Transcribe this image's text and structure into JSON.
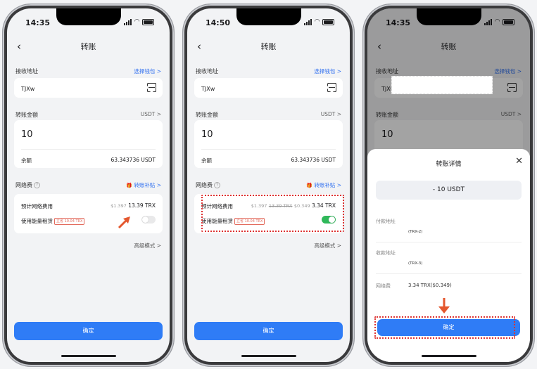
{
  "colors": {
    "accent": "#2f7cf6",
    "toggle_on": "#2fb85a",
    "highlight": "#dd3333"
  },
  "screens": [
    {
      "time": "14:35",
      "nav_title": "转账",
      "recipient_label": "接收地址",
      "select_wallet": "选择钱包 >",
      "address": "TJXw",
      "amount_label": "转账金额",
      "currency": "USDT >",
      "amount": "10",
      "balance_label": "余额",
      "balance_value": "63.343736 USDT",
      "fee_label": "网络费",
      "subsidy": "转账补贴 >",
      "estimated_fee_label": "预计网络费用",
      "fee_old": "$1.397",
      "fee_value": "13.39 TRX",
      "energy_rent_label": "使用能量租赁",
      "energy_tag": "立省 10.04 TRX",
      "energy_rent_on": false,
      "advanced": "高级模式 >",
      "confirm": "确定"
    },
    {
      "time": "14:50",
      "nav_title": "转账",
      "recipient_label": "接收地址",
      "select_wallet": "选择钱包 >",
      "address": "TJXw",
      "amount_label": "转账金额",
      "currency": "USDT >",
      "amount": "10",
      "balance_label": "余额",
      "balance_value": "63.343736 USDT",
      "fee_label": "网络费",
      "subsidy": "转账补贴 >",
      "estimated_fee_label": "预计网络费用",
      "fee_old": "$1.397",
      "fee_struck": "13.39 TRX",
      "fee_new_usd": "$0.349",
      "fee_value": "3.34 TRX",
      "energy_rent_label": "使用能量租赁",
      "energy_tag": "立省 10.04 TRX",
      "energy_rent_on": true,
      "advanced": "高级模式 >",
      "confirm": "确定"
    },
    {
      "time": "14:35",
      "nav_title": "转账",
      "recipient_label": "接收地址",
      "select_wallet": "选择钱包 >",
      "address": "TJXw",
      "amount_label": "转账金额",
      "currency": "USDT >",
      "amount": "10",
      "sheet_title": "转账详情",
      "sheet_amount": "- 10 USDT",
      "from_label": "付款地址",
      "from_hint": "(TRX-2)",
      "to_label": "收款地址",
      "to_hint": "(TRX-3)",
      "fee_label": "网络费",
      "fee_value": "3.34 TRX($0.349)",
      "confirm": "确定"
    }
  ]
}
